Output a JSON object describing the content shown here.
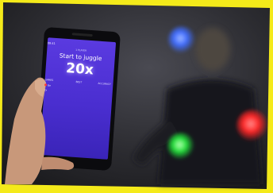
{
  "photo": {
    "border_color": "#f4ea1a",
    "background_color": "#2a2a2e",
    "screen_color": "#4a2fd6",
    "ball_colors": {
      "blue": "#3a6dff",
      "red": "#ff2a2a",
      "green": "#22e03a"
    }
  },
  "phone": {
    "status_time": "09:41",
    "status_right": "",
    "title_small": "1 PLAYER",
    "brand": "",
    "headline": "Start to juggle",
    "goal": "20x",
    "table": {
      "headers": [
        "GAMES",
        "BEST",
        "ACCURACY"
      ],
      "rows": [
        [
          "Be",
          "",
          ""
        ],
        [
          "2x",
          "",
          ""
        ]
      ]
    }
  }
}
